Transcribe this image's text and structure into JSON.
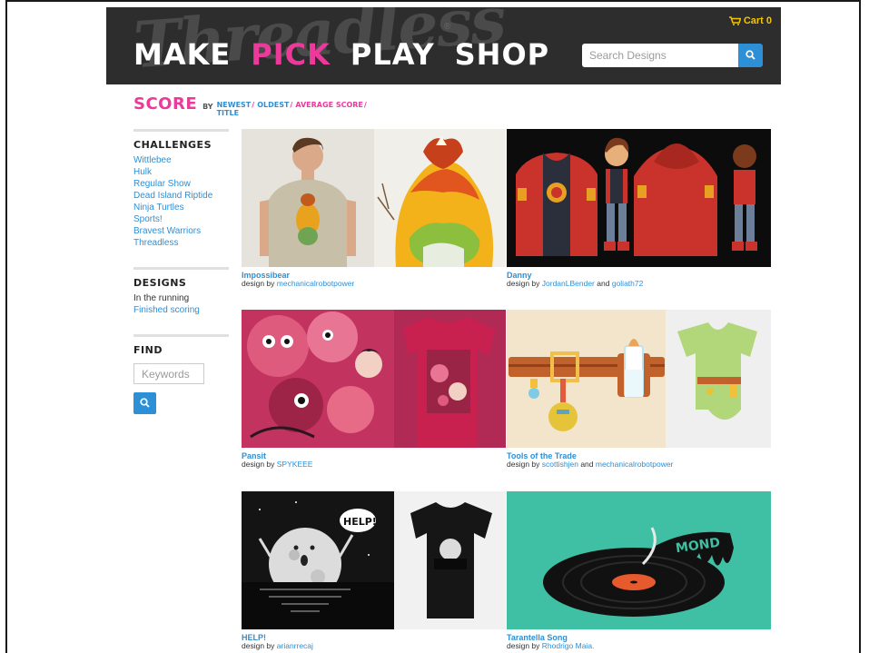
{
  "header": {
    "logo_text": "Threadless",
    "logo_mark": "®",
    "nav": [
      {
        "label": "MAKE",
        "active": false
      },
      {
        "label": "PICK",
        "active": true
      },
      {
        "label": "PLAY",
        "active": false
      },
      {
        "label": "SHOP",
        "active": false
      }
    ],
    "cart_label": "Cart 0",
    "cart_icon": "shopping-cart-icon",
    "search_placeholder": "Search Designs",
    "search_icon": "search-icon"
  },
  "sort": {
    "title": "SCORE",
    "by": "BY",
    "newest": "NEWEST",
    "title_link": "TITLE",
    "oldest": "OLDEST",
    "average": "AVERAGE SCORE",
    "separator": "/"
  },
  "sidebar": {
    "challenges_heading": "CHALLENGES",
    "challenges": [
      "Wittlebee",
      "Hulk",
      "Regular Show",
      "Dead Island Riptide",
      "Ninja Turtles",
      "Sports!",
      "Bravest Warriors",
      "Threadless"
    ],
    "designs_heading": "DESIGNS",
    "designs_in_running": "In the running",
    "designs_finished": "Finished scoring",
    "find_heading": "FIND",
    "find_placeholder": "Keywords"
  },
  "designs": [
    {
      "title": "Impossibear",
      "by_prefix": "design by",
      "authors": [
        "mechanicalrobotpower"
      ],
      "joiner": ""
    },
    {
      "title": "Danny",
      "by_prefix": "design by",
      "authors": [
        "JordanLBender",
        "goliath72"
      ],
      "joiner": "and"
    },
    {
      "title": "Pansit",
      "by_prefix": "design by",
      "authors": [
        "SPYKEEE"
      ],
      "joiner": ""
    },
    {
      "title": "Tools of the Trade",
      "by_prefix": "design by",
      "authors": [
        "scottishjen",
        "mechanicalrobotpower"
      ],
      "joiner": "and"
    },
    {
      "title": "HELP!",
      "by_prefix": "design by",
      "authors": [
        "arianrrecaj"
      ],
      "joiner": ""
    },
    {
      "title": "Tarantella Song",
      "by_prefix": "design by",
      "authors": [
        "Rhodrigo Maia."
      ],
      "joiner": ""
    }
  ],
  "image_texts": {
    "help_bubble": "HELP!",
    "record_drip": "MOND"
  },
  "colors": {
    "accent_pink": "#ec3a9b",
    "link_blue": "#2d8fd6",
    "header_bg": "#2d2d2d",
    "cart_yellow": "#f5c400"
  }
}
